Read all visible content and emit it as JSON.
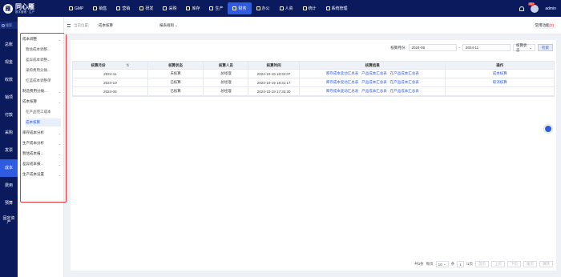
{
  "brand": {
    "name": "同心雁",
    "tagline": "数字管理 · 生产"
  },
  "topnav": [
    {
      "label": "GMP",
      "icon": "gmp-icon",
      "active": false
    },
    {
      "label": "销售",
      "icon": "sales-icon",
      "active": false
    },
    {
      "label": "营销",
      "icon": "marketing-icon",
      "active": false
    },
    {
      "label": "研发",
      "icon": "rnd-icon",
      "active": false
    },
    {
      "label": "采购",
      "icon": "purchase-icon",
      "active": false
    },
    {
      "label": "库存",
      "icon": "inventory-icon",
      "active": false
    },
    {
      "label": "生产",
      "icon": "production-icon",
      "active": false
    },
    {
      "label": "财务",
      "icon": "finance-icon",
      "active": true
    },
    {
      "label": "办公",
      "icon": "office-icon",
      "active": false
    },
    {
      "label": "人资",
      "icon": "hr-icon",
      "active": false
    },
    {
      "label": "统计",
      "icon": "stats-icon",
      "active": false
    },
    {
      "label": "系统管理",
      "icon": "settings-icon",
      "active": false
    }
  ],
  "user": {
    "name": "admin",
    "badge": "99+"
  },
  "leftnav": {
    "search_placeholder": "搜索",
    "items": [
      {
        "label": "总账",
        "active": false
      },
      {
        "label": "现金",
        "active": false
      },
      {
        "label": "收款",
        "active": false
      },
      {
        "label": "销项",
        "active": false
      },
      {
        "label": "付款",
        "active": false
      },
      {
        "label": "采购",
        "active": false
      },
      {
        "label": "发票",
        "active": false
      },
      {
        "label": "成本",
        "active": true
      },
      {
        "label": "费用",
        "active": false
      },
      {
        "label": "预算",
        "active": false
      },
      {
        "label": "固定资产",
        "active": false
      }
    ]
  },
  "submenu": [
    {
      "label": "成本调整",
      "child": false,
      "selected": false,
      "chevron": true
    },
    {
      "label": "暂估成本调整...",
      "child": true,
      "selected": false,
      "chevron": false
    },
    {
      "label": "差异成本调整...",
      "child": true,
      "selected": false,
      "chevron": false
    },
    {
      "label": "采购费用分摊...",
      "child": true,
      "selected": false,
      "chevron": false
    },
    {
      "label": "红蓝成本调整单",
      "child": true,
      "selected": false,
      "chevron": false
    },
    {
      "label": "制造费用分摊...",
      "child": false,
      "selected": false,
      "chevron": true
    },
    {
      "label": "成本核算",
      "child": false,
      "selected": false,
      "chevron": true
    },
    {
      "label": "在产品完工成本",
      "child": true,
      "selected": false,
      "chevron": false
    },
    {
      "label": "成本核算",
      "child": true,
      "selected": true,
      "chevron": false
    },
    {
      "label": "库存成本分析",
      "child": false,
      "selected": false,
      "chevron": true
    },
    {
      "label": "生产成本分析",
      "child": false,
      "selected": false,
      "chevron": true
    },
    {
      "label": "暂估成本报...",
      "child": false,
      "selected": false,
      "chevron": true
    },
    {
      "label": "差异成本报...",
      "child": false,
      "selected": false,
      "chevron": true
    },
    {
      "label": "生产成本设置",
      "child": false,
      "selected": false,
      "chevron": true
    }
  ],
  "tabbar": {
    "location_label": "当前位置:",
    "page_title": "成本核算",
    "tab_label": "报表规则",
    "func_label": "常用功能",
    "func_count": "(3)"
  },
  "filter": {
    "label": "核算月份:",
    "from": "2024-09",
    "sep": "-",
    "to": "2024-11",
    "status_label": "核算状态",
    "query": "检索"
  },
  "table": {
    "headers": [
      "核算月份",
      "核算状态",
      "核算人员",
      "核算时间",
      "核算结果",
      "操作"
    ],
    "rows": [
      {
        "month": "2024-11",
        "status": "未核算",
        "person": "总经理",
        "time": "2024-10-19 18:32:07",
        "results": [
          "库存成本变动汇总表",
          "产品成本汇总表",
          "在产品成本汇总表"
        ],
        "op": "成本核算"
      },
      {
        "month": "2024-10",
        "status": "已核算",
        "person": "总经理",
        "time": "2024-10-19 18:31:17",
        "results": [
          "库存成本变动汇总表",
          "产品成本汇总表",
          "在产品成本汇总表"
        ],
        "op": "取消核算"
      },
      {
        "month": "2024-09",
        "status": "已核算",
        "person": "总经理",
        "time": "2024-10-19 17:33:30",
        "results": [
          "库存成本变动汇总表",
          "产品成本汇总表",
          "在产品成本汇总表"
        ],
        "op": ""
      }
    ]
  },
  "pager": {
    "total": "共3条",
    "per_label": "每页",
    "per": "10",
    "unit": "条",
    "page": "1",
    "pages": "/1页",
    "buttons": [
      "首页",
      "上页",
      "下页",
      "尾页"
    ],
    "go": "跳转"
  }
}
